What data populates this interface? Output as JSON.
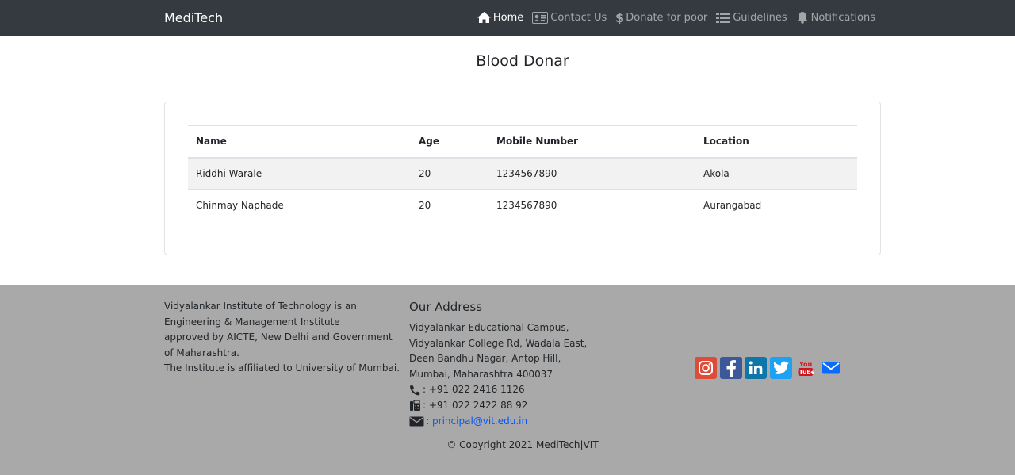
{
  "navbar": {
    "brand": "MediTech",
    "items": [
      {
        "label": "Home",
        "icon": "home-icon"
      },
      {
        "label": "Contact Us",
        "icon": "id-card-icon"
      },
      {
        "label": "Donate for poor",
        "icon": "dollar-icon"
      },
      {
        "label": "Guidelines",
        "icon": "list-icon"
      },
      {
        "label": "Notifications",
        "icon": "bell-icon"
      }
    ]
  },
  "page": {
    "title": "Blood Donar"
  },
  "table": {
    "headers": [
      "Name",
      "Age",
      "Mobile Number",
      "Location"
    ],
    "rows": [
      [
        "Riddhi Warale",
        "20",
        "1234567890",
        "Akola"
      ],
      [
        "Chinmay Naphade",
        "20",
        "1234567890",
        "Aurangabad"
      ]
    ]
  },
  "footer": {
    "about": [
      "Vidyalankar Institute of Technology is an",
      "Engineering & Management Institute",
      "approved by AICTE, New Delhi and Government",
      "of Maharashtra.",
      "The Institute is affiliated to University of Mumbai."
    ],
    "address_title": "Our Address",
    "address": [
      "Vidyalankar Educational Campus,",
      "Vidyalankar College Rd, Wadala East,",
      "Deen Bandhu Nagar, Antop Hill,",
      "Mumbai, Maharashtra 400037"
    ],
    "phone": ": +91 022 2416 1126",
    "fax": ": +91 022 2422 88 92",
    "email_sep": ":",
    "email": "principal@vit.edu.in",
    "social": [
      "instagram-icon",
      "facebook-icon",
      "linkedin-icon",
      "twitter-icon",
      "youtube-icon",
      "mail-icon"
    ],
    "copyright": "© Copyright 2021 MediTech|VIT"
  },
  "colors": {
    "navbar_bg": "#343a40",
    "footer_bg": "#a9a9a9",
    "link": "#0056ff"
  }
}
